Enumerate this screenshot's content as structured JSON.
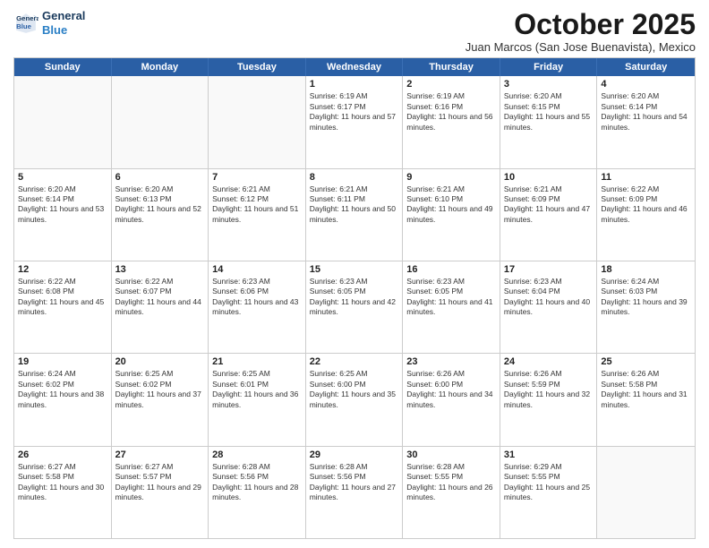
{
  "logo": {
    "line1": "General",
    "line2": "Blue"
  },
  "title": "October 2025",
  "subtitle": "Juan Marcos (San Jose Buenavista), Mexico",
  "headers": [
    "Sunday",
    "Monday",
    "Tuesday",
    "Wednesday",
    "Thursday",
    "Friday",
    "Saturday"
  ],
  "weeks": [
    [
      {
        "day": "",
        "info": ""
      },
      {
        "day": "",
        "info": ""
      },
      {
        "day": "",
        "info": ""
      },
      {
        "day": "1",
        "info": "Sunrise: 6:19 AM\nSunset: 6:17 PM\nDaylight: 11 hours and 57 minutes."
      },
      {
        "day": "2",
        "info": "Sunrise: 6:19 AM\nSunset: 6:16 PM\nDaylight: 11 hours and 56 minutes."
      },
      {
        "day": "3",
        "info": "Sunrise: 6:20 AM\nSunset: 6:15 PM\nDaylight: 11 hours and 55 minutes."
      },
      {
        "day": "4",
        "info": "Sunrise: 6:20 AM\nSunset: 6:14 PM\nDaylight: 11 hours and 54 minutes."
      }
    ],
    [
      {
        "day": "5",
        "info": "Sunrise: 6:20 AM\nSunset: 6:14 PM\nDaylight: 11 hours and 53 minutes."
      },
      {
        "day": "6",
        "info": "Sunrise: 6:20 AM\nSunset: 6:13 PM\nDaylight: 11 hours and 52 minutes."
      },
      {
        "day": "7",
        "info": "Sunrise: 6:21 AM\nSunset: 6:12 PM\nDaylight: 11 hours and 51 minutes."
      },
      {
        "day": "8",
        "info": "Sunrise: 6:21 AM\nSunset: 6:11 PM\nDaylight: 11 hours and 50 minutes."
      },
      {
        "day": "9",
        "info": "Sunrise: 6:21 AM\nSunset: 6:10 PM\nDaylight: 11 hours and 49 minutes."
      },
      {
        "day": "10",
        "info": "Sunrise: 6:21 AM\nSunset: 6:09 PM\nDaylight: 11 hours and 47 minutes."
      },
      {
        "day": "11",
        "info": "Sunrise: 6:22 AM\nSunset: 6:09 PM\nDaylight: 11 hours and 46 minutes."
      }
    ],
    [
      {
        "day": "12",
        "info": "Sunrise: 6:22 AM\nSunset: 6:08 PM\nDaylight: 11 hours and 45 minutes."
      },
      {
        "day": "13",
        "info": "Sunrise: 6:22 AM\nSunset: 6:07 PM\nDaylight: 11 hours and 44 minutes."
      },
      {
        "day": "14",
        "info": "Sunrise: 6:23 AM\nSunset: 6:06 PM\nDaylight: 11 hours and 43 minutes."
      },
      {
        "day": "15",
        "info": "Sunrise: 6:23 AM\nSunset: 6:05 PM\nDaylight: 11 hours and 42 minutes."
      },
      {
        "day": "16",
        "info": "Sunrise: 6:23 AM\nSunset: 6:05 PM\nDaylight: 11 hours and 41 minutes."
      },
      {
        "day": "17",
        "info": "Sunrise: 6:23 AM\nSunset: 6:04 PM\nDaylight: 11 hours and 40 minutes."
      },
      {
        "day": "18",
        "info": "Sunrise: 6:24 AM\nSunset: 6:03 PM\nDaylight: 11 hours and 39 minutes."
      }
    ],
    [
      {
        "day": "19",
        "info": "Sunrise: 6:24 AM\nSunset: 6:02 PM\nDaylight: 11 hours and 38 minutes."
      },
      {
        "day": "20",
        "info": "Sunrise: 6:25 AM\nSunset: 6:02 PM\nDaylight: 11 hours and 37 minutes."
      },
      {
        "day": "21",
        "info": "Sunrise: 6:25 AM\nSunset: 6:01 PM\nDaylight: 11 hours and 36 minutes."
      },
      {
        "day": "22",
        "info": "Sunrise: 6:25 AM\nSunset: 6:00 PM\nDaylight: 11 hours and 35 minutes."
      },
      {
        "day": "23",
        "info": "Sunrise: 6:26 AM\nSunset: 6:00 PM\nDaylight: 11 hours and 34 minutes."
      },
      {
        "day": "24",
        "info": "Sunrise: 6:26 AM\nSunset: 5:59 PM\nDaylight: 11 hours and 32 minutes."
      },
      {
        "day": "25",
        "info": "Sunrise: 6:26 AM\nSunset: 5:58 PM\nDaylight: 11 hours and 31 minutes."
      }
    ],
    [
      {
        "day": "26",
        "info": "Sunrise: 6:27 AM\nSunset: 5:58 PM\nDaylight: 11 hours and 30 minutes."
      },
      {
        "day": "27",
        "info": "Sunrise: 6:27 AM\nSunset: 5:57 PM\nDaylight: 11 hours and 29 minutes."
      },
      {
        "day": "28",
        "info": "Sunrise: 6:28 AM\nSunset: 5:56 PM\nDaylight: 11 hours and 28 minutes."
      },
      {
        "day": "29",
        "info": "Sunrise: 6:28 AM\nSunset: 5:56 PM\nDaylight: 11 hours and 27 minutes."
      },
      {
        "day": "30",
        "info": "Sunrise: 6:28 AM\nSunset: 5:55 PM\nDaylight: 11 hours and 26 minutes."
      },
      {
        "day": "31",
        "info": "Sunrise: 6:29 AM\nSunset: 5:55 PM\nDaylight: 11 hours and 25 minutes."
      },
      {
        "day": "",
        "info": ""
      }
    ]
  ]
}
